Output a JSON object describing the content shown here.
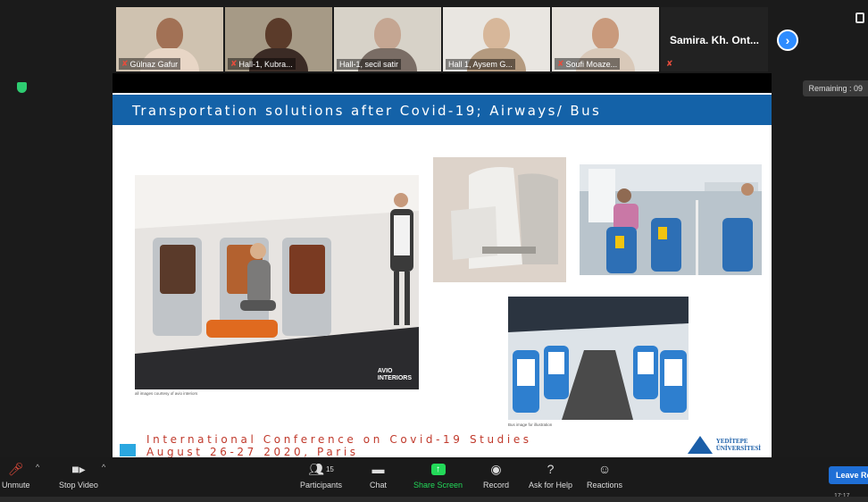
{
  "participants": [
    {
      "name": "Gülnaz Gafur",
      "muted": true
    },
    {
      "name": "Hall-1, Kubra...",
      "muted": true
    },
    {
      "name": "Hall-1, secil satir",
      "muted": false
    },
    {
      "name": "Hall 1, Aysem G...",
      "muted": false
    },
    {
      "name": "Soufi Moaze...",
      "muted": true
    }
  ],
  "active_speaker": {
    "name": "Samira. Kh. Ont..."
  },
  "remaining_label": "Remaining : 09",
  "slide": {
    "title": "Transportation solutions after Covid-19; Airways/ Bus",
    "cabin_caption": "all images courtesy of avio interiors",
    "bus_caption": "Bus image for illustration",
    "cabin_logo_line1": "AVIO",
    "cabin_logo_line2": "INTERIORS",
    "conference_line1": "International Conference on Covid-19 Studies",
    "conference_line2": "August 26-27 2020, Paris",
    "university_line1": "YEDİTEPE",
    "university_line2": "ÜNİVERSİTESİ"
  },
  "toolbar": {
    "unmute": "Unmute",
    "stop_video": "Stop Video",
    "participants": "Participants",
    "participants_count": "15",
    "chat": "Chat",
    "share_screen": "Share Screen",
    "record": "Record",
    "ask_for_help": "Ask for Help",
    "reactions": "Reactions",
    "leave": "Leave Re"
  },
  "clock": "17:17",
  "colors": {
    "zoom_blue": "#2d8cff",
    "slide_title_bar": "#1462a8",
    "conference_text": "#c0392b",
    "share_green": "#23d959"
  },
  "icons": [
    "mic-muted-icon",
    "video-icon",
    "participants-icon",
    "chat-icon",
    "share-screen-icon",
    "record-icon",
    "help-icon",
    "reactions-icon",
    "shield-icon",
    "next-page-icon"
  ]
}
